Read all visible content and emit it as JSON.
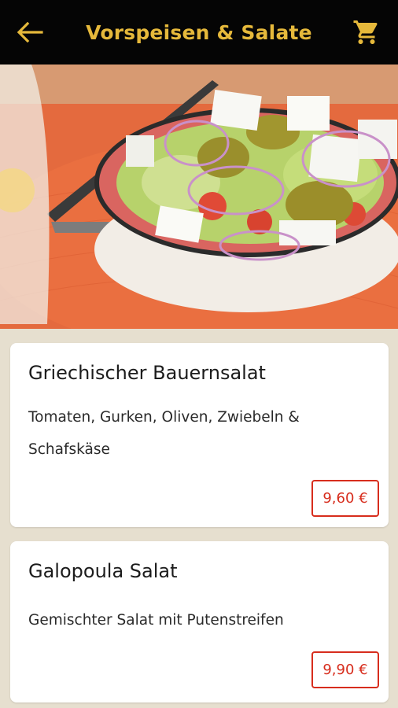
{
  "header": {
    "title": "Vorspeisen & Salate",
    "back_icon": "arrow-left-icon",
    "cart_icon": "shopping-cart-icon",
    "accent_color": "#e6b93b",
    "background_color": "#050505"
  },
  "hero": {
    "description": "Greek salad in a bowl on an orange placemat"
  },
  "items": [
    {
      "name": "Griechischer Bauernsalat",
      "description": "Tomaten, Gurken, Oliven, Zwiebeln & Schafskäse",
      "price": "9,60 €"
    },
    {
      "name": "Galopoula Salat",
      "description": "Gemischter Salat mit Putenstreifen",
      "price": "9,90 €"
    }
  ],
  "colors": {
    "price_accent": "#d72d1d",
    "page_background": "#e6dfcf"
  }
}
